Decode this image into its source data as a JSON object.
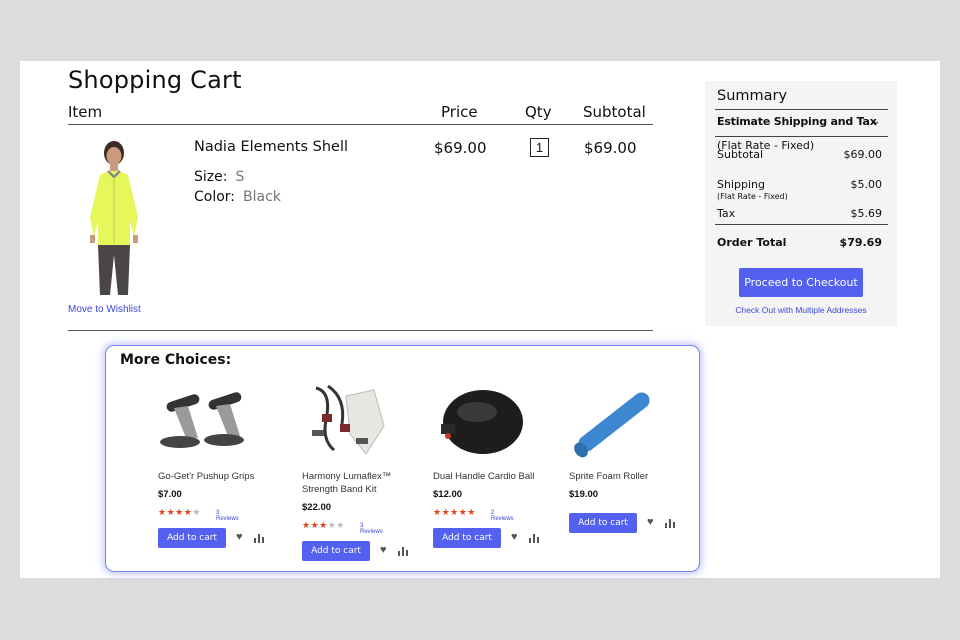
{
  "cart": {
    "title": "Shopping Cart",
    "headers": {
      "item": "Item",
      "price": "Price",
      "qty": "Qty",
      "subtotal": "Subtotal"
    },
    "item": {
      "name": "Nadia Elements Shell",
      "size_label": "Size:",
      "size_value": "S",
      "color_label": "Color:",
      "color_value": "Black",
      "price": "$69.00",
      "qty": "1",
      "subtotal": "$69.00",
      "wishlist_link": "Move to Wishlist"
    }
  },
  "summary": {
    "title": "Summary",
    "estimate": "Estimate Shipping and Tax",
    "flat_rate_overlap": "(Flat Rate - Fixed)",
    "subtotal_label": "Subtotal",
    "subtotal_value": "$69.00",
    "shipping_label": "Shipping",
    "shipping_note": "(Flat Rate - Fixed)",
    "shipping_value": "$5.00",
    "tax_label": "Tax",
    "tax_value": "$5.69",
    "total_label": "Order Total",
    "total_value": "$79.69",
    "checkout_button": "Proceed to Checkout",
    "multi_link": "Check Out with Multiple Addresses"
  },
  "choices": {
    "title": "More Choices:",
    "add_label": "Add to cart",
    "products": [
      {
        "name": "Go-Get'r Pushup Grips",
        "price": "$7.00",
        "rating": 4,
        "reviews": "3 Reviews"
      },
      {
        "name": "Harmony Lumaflex™ Strength Band Kit",
        "price": "$22.00",
        "rating": 3,
        "reviews": "3 Reviews"
      },
      {
        "name": "Dual Handle Cardio Ball",
        "price": "$12.00",
        "rating": 5,
        "reviews": "2 Reviews"
      },
      {
        "name": "Sprite Foam Roller",
        "price": "$19.00"
      }
    ]
  },
  "colors": {
    "accent": "#5360f0",
    "link": "#3a49d6",
    "star": "#e3421a",
    "jacket": "#e6f75c"
  }
}
